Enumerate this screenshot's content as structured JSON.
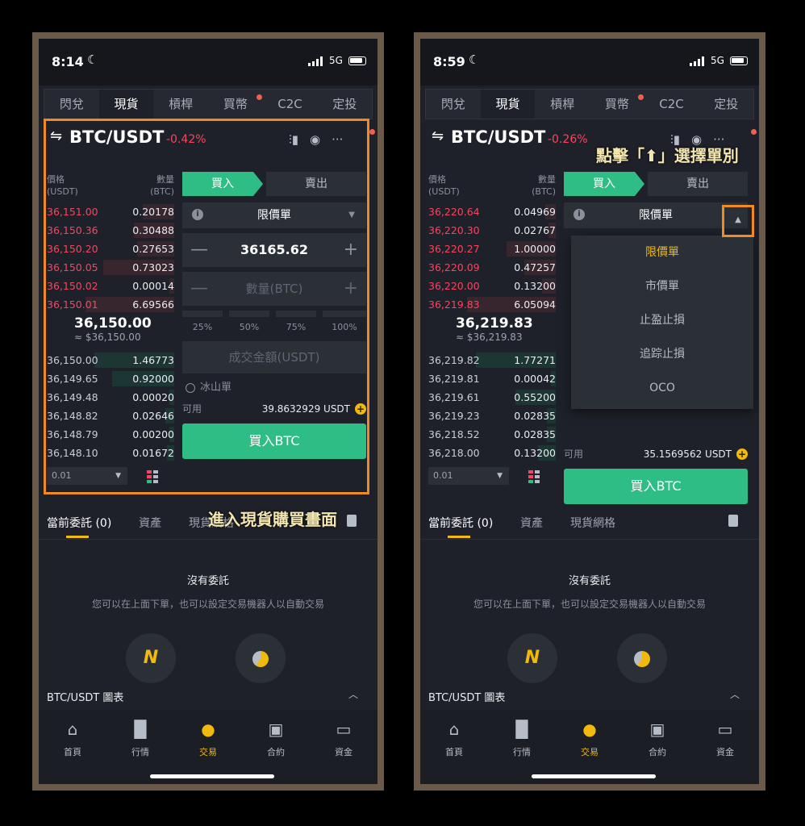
{
  "panels": [
    {
      "time": "8:14",
      "network": "5G",
      "tabs": [
        {
          "label": "閃兌"
        },
        {
          "label": "現貨"
        },
        {
          "label": "槓桿"
        },
        {
          "label": "買幣"
        },
        {
          "label": "C2C"
        },
        {
          "label": "定投"
        }
      ],
      "pair": "BTC/USDT",
      "change": "-0.42%",
      "book_header": {
        "price": "價格",
        "price_unit": "(USDT)",
        "qty": "數量",
        "qty_unit": "(BTC)"
      },
      "asks": [
        {
          "price": "36,151.00",
          "qty": "0.20178",
          "depth": 0.35
        },
        {
          "price": "36,150.36",
          "qty": "0.30488",
          "depth": 0.45
        },
        {
          "price": "36,150.20",
          "qty": "0.27653",
          "depth": 0.42
        },
        {
          "price": "36,150.05",
          "qty": "0.73023",
          "depth": 0.8
        },
        {
          "price": "36,150.02",
          "qty": "0.00014",
          "depth": 0.05
        },
        {
          "price": "36,150.01",
          "qty": "6.69566",
          "depth": 1.0
        }
      ],
      "mid_price": "36,150.00",
      "mid_fiat": "≈ $36,150.00",
      "bids": [
        {
          "price": "36,150.00",
          "qty": "1.46773",
          "depth": 0.9
        },
        {
          "price": "36,149.65",
          "qty": "0.92000",
          "depth": 0.7
        },
        {
          "price": "36,149.48",
          "qty": "0.00020",
          "depth": 0.05
        },
        {
          "price": "36,148.82",
          "qty": "0.02646",
          "depth": 0.1
        },
        {
          "price": "36,148.79",
          "qty": "0.00200",
          "depth": 0.05
        },
        {
          "price": "36,148.10",
          "qty": "0.01672",
          "depth": 0.08
        }
      ],
      "step": "0.01",
      "buy_label": "買入",
      "sell_label": "賣出",
      "order_type": "限價單",
      "price_value": "36165.62",
      "qty_placeholder": "數量(BTC)",
      "percents": [
        "25%",
        "50%",
        "75%",
        "100%"
      ],
      "total_placeholder": "成交金額(USDT)",
      "iceberg": "冰山單",
      "avail_label": "可用",
      "avail_value": "39.8632929 USDT",
      "buy_button": "買入BTC",
      "order_tabs": [
        {
          "label": "當前委託 (0)"
        },
        {
          "label": "資產"
        },
        {
          "label": "現貨網格"
        }
      ],
      "empty_title": "沒有委託",
      "empty_sub": "您可以在上面下單，也可以設定交易機器人以自動交易",
      "chart_label": "BTC/USDT 圖表",
      "nav": [
        {
          "label": "首頁"
        },
        {
          "label": "行情"
        },
        {
          "label": "交易"
        },
        {
          "label": "合約"
        },
        {
          "label": "資金"
        }
      ],
      "annotation": "進入現貨購買畫面"
    },
    {
      "time": "8:59",
      "network": "5G",
      "tabs": [
        {
          "label": "閃兌"
        },
        {
          "label": "現貨"
        },
        {
          "label": "槓桿"
        },
        {
          "label": "買幣"
        },
        {
          "label": "C2C"
        },
        {
          "label": "定投"
        }
      ],
      "pair": "BTC/USDT",
      "change": "-0.26%",
      "book_header": {
        "price": "價格",
        "price_unit": "(USDT)",
        "qty": "數量",
        "qty_unit": "(BTC)"
      },
      "asks": [
        {
          "price": "36,220.64",
          "qty": "0.04969",
          "depth": 0.12
        },
        {
          "price": "36,220.30",
          "qty": "0.02767",
          "depth": 0.08
        },
        {
          "price": "36,220.27",
          "qty": "1.00000",
          "depth": 0.55
        },
        {
          "price": "36,220.09",
          "qty": "0.47257",
          "depth": 0.35
        },
        {
          "price": "36,220.00",
          "qty": "0.13200",
          "depth": 0.15
        },
        {
          "price": "36,219.83",
          "qty": "6.05094",
          "depth": 1.0
        }
      ],
      "mid_price": "36,219.83",
      "mid_fiat": "≈ $36,219.83",
      "bids": [
        {
          "price": "36,219.82",
          "qty": "1.77271",
          "depth": 0.9
        },
        {
          "price": "36,219.81",
          "qty": "0.00042",
          "depth": 0.05
        },
        {
          "price": "36,219.61",
          "qty": "0.55200",
          "depth": 0.45
        },
        {
          "price": "36,219.23",
          "qty": "0.02835",
          "depth": 0.1
        },
        {
          "price": "36,218.52",
          "qty": "0.02835",
          "depth": 0.1
        },
        {
          "price": "36,218.00",
          "qty": "0.13200",
          "depth": 0.2
        }
      ],
      "step": "0.01",
      "buy_label": "買入",
      "sell_label": "賣出",
      "order_type": "限價單",
      "dropdown_options": [
        {
          "label": "限價單"
        },
        {
          "label": "市價單"
        },
        {
          "label": "止盈止損"
        },
        {
          "label": "追踪止損"
        },
        {
          "label": "OCO"
        }
      ],
      "avail_label": "可用",
      "avail_value": "35.1569562 USDT",
      "buy_button": "買入BTC",
      "order_tabs": [
        {
          "label": "當前委託 (0)"
        },
        {
          "label": "資產"
        },
        {
          "label": "現貨網格"
        }
      ],
      "empty_title": "沒有委託",
      "empty_sub": "您可以在上面下單，也可以設定交易機器人以自動交易",
      "chart_label": "BTC/USDT 圖表",
      "nav": [
        {
          "label": "首頁"
        },
        {
          "label": "行情"
        },
        {
          "label": "交易"
        },
        {
          "label": "合約"
        },
        {
          "label": "資金"
        }
      ],
      "annotation": "點擊「⬆」選擇單別"
    }
  ],
  "colors": {
    "buy": "#2ebd85",
    "sell": "#f6465d",
    "accent": "#f0b90b",
    "highlight": "#f08a24"
  }
}
